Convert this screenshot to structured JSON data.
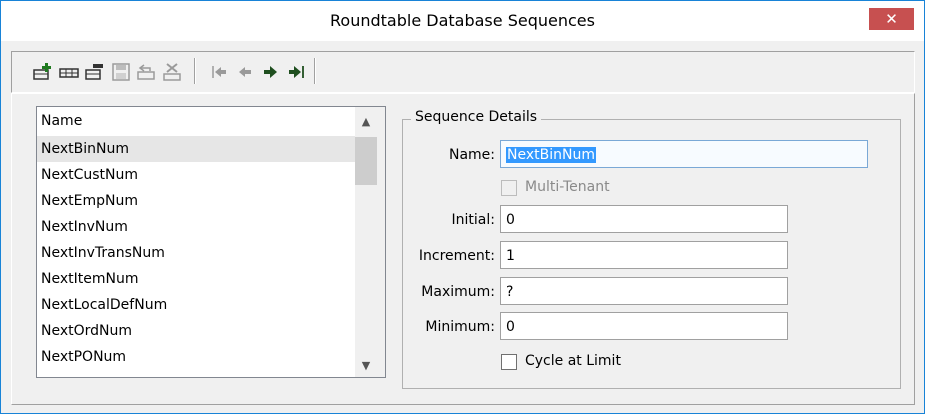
{
  "window": {
    "title": "Roundtable Database Sequences",
    "close_glyph": "✕"
  },
  "toolbar": {
    "buttons": [
      {
        "name": "add-icon",
        "enabled": true
      },
      {
        "name": "copy-icon",
        "enabled": true
      },
      {
        "name": "modify-icon",
        "enabled": true
      },
      {
        "name": "save-icon",
        "enabled": false
      },
      {
        "name": "undo-icon",
        "enabled": false
      },
      {
        "name": "delete-icon",
        "enabled": false
      },
      {
        "name": "first-record-icon",
        "enabled": true
      },
      {
        "name": "previous-record-icon",
        "enabled": true
      },
      {
        "name": "next-record-icon",
        "enabled": true
      },
      {
        "name": "last-record-icon",
        "enabled": true
      }
    ],
    "colors": {
      "arrow": "#1f4f1f",
      "disabled": "#9a9a9a"
    }
  },
  "list": {
    "header": "Name",
    "items": [
      "NextBinNum",
      "NextCustNum",
      "NextEmpNum",
      "NextInvNum",
      "NextInvTransNum",
      "NextItemNum",
      "NextLocalDefNum",
      "NextOrdNum",
      "NextPONum"
    ],
    "selected_index": 0
  },
  "details": {
    "group_title": "Sequence Details",
    "name": {
      "label": "Name:",
      "value": "NextBinNum"
    },
    "multi_tenant": {
      "label": "Multi-Tenant",
      "checked": false,
      "enabled": false
    },
    "initial": {
      "label": "Initial:",
      "value": "0"
    },
    "increment": {
      "label": "Increment:",
      "value": "1"
    },
    "maximum": {
      "label": "Maximum:",
      "value": "?"
    },
    "minimum": {
      "label": "Minimum:",
      "value": "0"
    },
    "cycle": {
      "label": "Cycle at Limit",
      "checked": false
    }
  }
}
